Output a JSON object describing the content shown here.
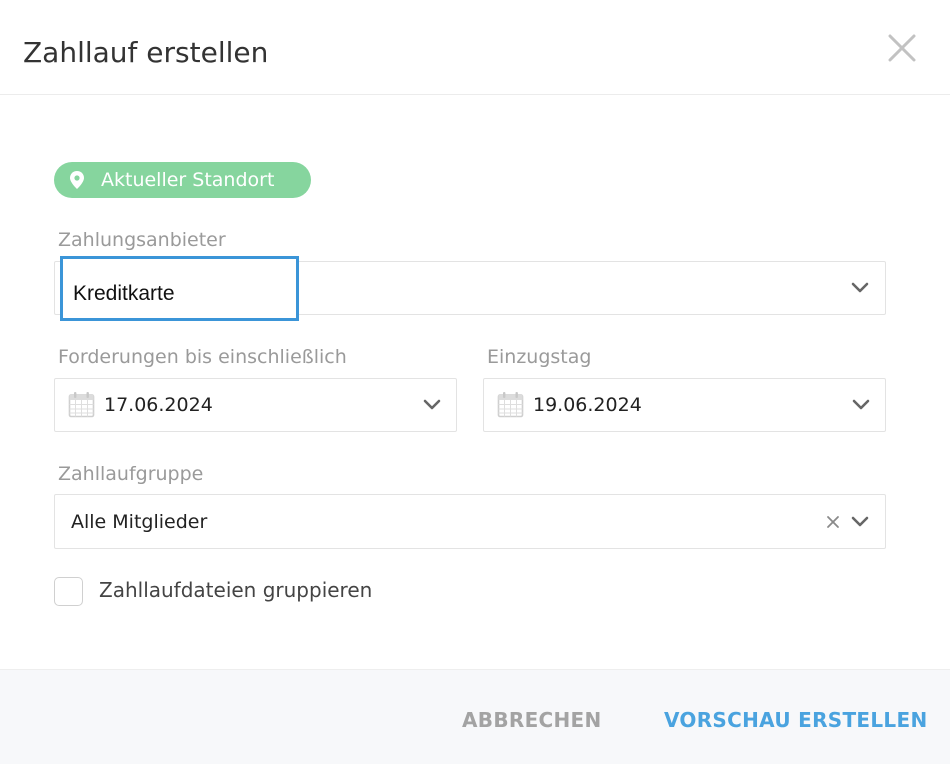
{
  "dialog": {
    "title": "Zahllauf erstellen"
  },
  "location": {
    "label": "Aktueller Standort",
    "color": "#86d59e",
    "icon": "map-pin-icon"
  },
  "payment_provider": {
    "label": "Zahlungsanbieter",
    "value": "Kreditkarte"
  },
  "claims_until": {
    "label": "Forderungen bis einschließlich",
    "value": "17.06.2024",
    "icon": "calendar-icon"
  },
  "collection_day": {
    "label": "Einzugstag",
    "value": "19.06.2024",
    "icon": "calendar-icon"
  },
  "run_group": {
    "label": "Zahllaufgruppe",
    "value": "Alle Mitglieder"
  },
  "group_files": {
    "label": "Zahllaufdateien gruppieren",
    "checked": false
  },
  "footer": {
    "cancel_label": "ABBRECHEN",
    "primary_label": "VORSCHAU ERSTELLEN",
    "primary_color": "#4aa3df",
    "highlight_color": "#3b95d8"
  }
}
